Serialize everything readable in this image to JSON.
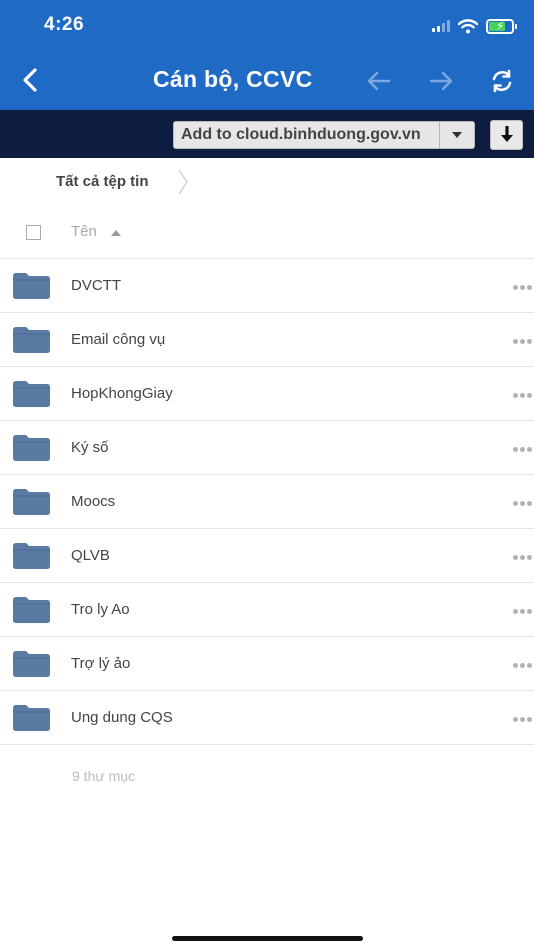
{
  "status_bar": {
    "time": "4:26",
    "icons": [
      "signal-icon",
      "wifi-icon",
      "battery-charging-icon"
    ]
  },
  "nav": {
    "title": "Cán bộ, CCVC",
    "icons": [
      "back-chevron-icon",
      "arrow-left-icon",
      "arrow-right-icon",
      "refresh-icon"
    ]
  },
  "toolbar": {
    "cloud_select_value": "Add to cloud.binhduong.gov.vn",
    "download_icon": "download-arrow-icon"
  },
  "breadcrumb": {
    "label": "Tất cả tệp tin"
  },
  "list": {
    "column_name": "Tên",
    "folders": [
      "DVCTT",
      "Email công vụ",
      "HopKhongGiay",
      "Ký số",
      "Moocs",
      "QLVB",
      "Tro ly Ao",
      "Trợ lý ảo",
      "Ung dung CQS"
    ],
    "summary": "9 thư mục"
  },
  "colors": {
    "header_blue": "#1f6ac5",
    "toolbar_navy": "#0e1d3f",
    "folder_blue": "#587aa3",
    "battery_green": "#48d45b"
  }
}
